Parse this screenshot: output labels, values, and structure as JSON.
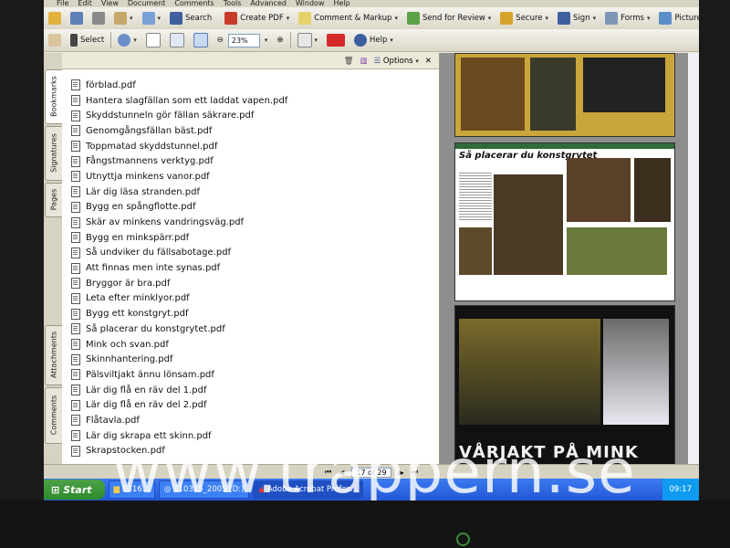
{
  "menu": [
    "File",
    "Edit",
    "View",
    "Document",
    "Comments",
    "Tools",
    "Advanced",
    "Window",
    "Help"
  ],
  "toolbar1": {
    "search": "Search",
    "create_pdf": "Create PDF",
    "comment_markup": "Comment & Markup",
    "send_review": "Send for Review",
    "secure": "Secure",
    "sign": "Sign",
    "forms": "Forms",
    "picture_tasks": "Picture Tasks"
  },
  "toolbar2": {
    "select": "Select",
    "zoom": "23%",
    "help": "Help"
  },
  "side_tabs": [
    "Bookmarks",
    "Signatures",
    "Pages",
    "Attachments",
    "Comments"
  ],
  "nav_header": {
    "options": "Options"
  },
  "files": [
    "förblad.pdf",
    "Hantera slagfällan som ett laddat vapen.pdf",
    "Skyddstunneln gör fällan säkrare.pdf",
    "Genomgångsfällan bäst.pdf",
    "Toppmatad skyddstunnel.pdf",
    "Fångstmannens verktyg.pdf",
    "Utnyttja minkens vanor.pdf",
    "Lär dig läsa stranden.pdf",
    "Bygg en spångflotte.pdf",
    "Skär av minkens vandringsväg.pdf",
    "Bygg en minkspärr.pdf",
    "Så undviker du fällsabotage.pdf",
    "Att finnas men inte synas.pdf",
    "Bryggor är bra.pdf",
    "Leta efter minklyor.pdf",
    "Bygg ett konstgryt.pdf",
    "Så placerar du konstgrytet.pdf",
    "Mink och svan.pdf",
    "Skinnhantering.pdf",
    "Pälsviltjakt ännu lönsam.pdf",
    "Lär dig flå en räv del 1.pdf",
    "Lär dig flå en räv del 2.pdf",
    "Flåtavla.pdf",
    "Lär dig skrapa ett skinn.pdf",
    "Skrapstocken.pdf"
  ],
  "pages": {
    "p2_title": "Så placerar du konstgrytet",
    "p3_title": "VÅRJAKT PÅ MINK"
  },
  "status": {
    "page": "17 of 29"
  },
  "taskbar": {
    "start": "Start",
    "task1": "0316...",
    "task2": "110315_2005 (D:)",
    "task3": "Adobe Acrobat Profes...",
    "clock": "09:17"
  },
  "watermark": "www.trappern.se",
  "colors": {
    "taskbar": "#2457d6",
    "start": "#2f8a2c",
    "toolbar": "#ece9d8"
  }
}
